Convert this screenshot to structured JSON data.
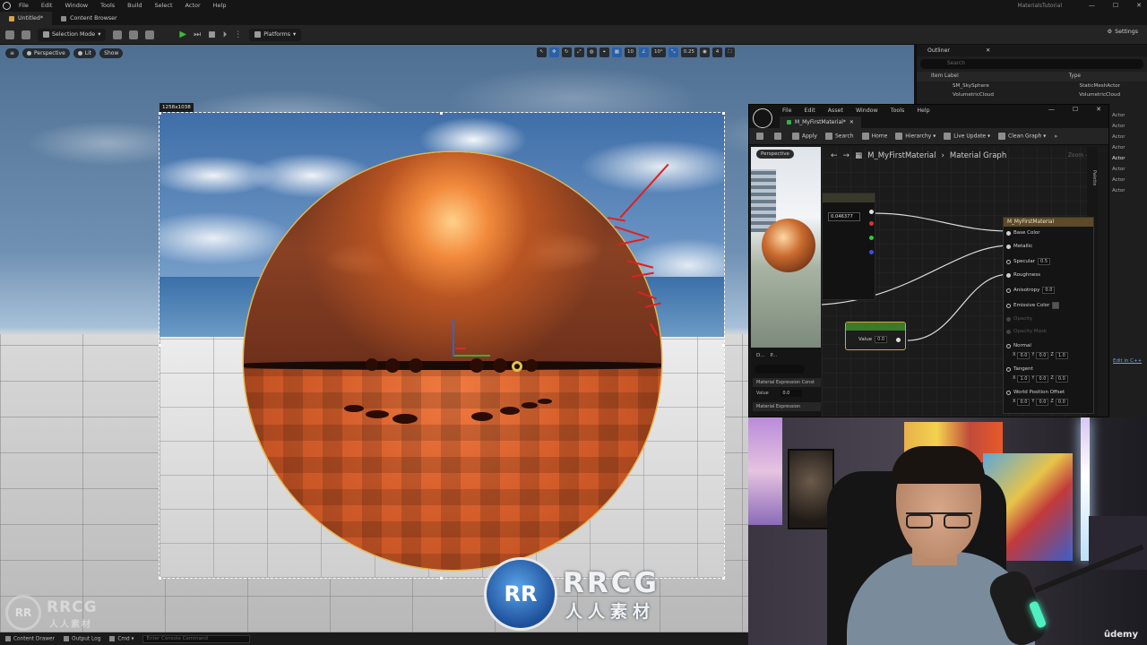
{
  "menubar": {
    "items": [
      "File",
      "Edit",
      "Window",
      "Tools",
      "Build",
      "Select",
      "Actor",
      "Help"
    ],
    "project_title": "MaterialsTutorial",
    "window_controls": [
      "—",
      "☐",
      "✕"
    ]
  },
  "tabs": [
    {
      "label": "Untitled*"
    },
    {
      "label": "Content Browser"
    }
  ],
  "toolbar": {
    "selection_mode": "Selection Mode",
    "platforms": "Platforms",
    "settings": "Settings"
  },
  "viewport": {
    "perspective": "Perspective",
    "lit": "Lit",
    "show": "Show",
    "resolution": "1258x1038",
    "snap_values": [
      "10",
      "10°",
      "0.25",
      "4"
    ]
  },
  "statusbar": {
    "content_drawer": "Content Drawer",
    "output_log": "Output Log",
    "cmd": "Cmd",
    "console_placeholder": "Enter Console Command"
  },
  "outliner": {
    "title": "Outliner",
    "search_placeholder": "Search",
    "col_label": "Item Label",
    "col_type": "Type",
    "rows": [
      {
        "label": "SM_SkySphere",
        "type": "StaticMeshActor"
      },
      {
        "label": "VolumetricCloud",
        "type": "VolumetricCloud"
      }
    ],
    "type_column": [
      "Actor",
      "Actor",
      "Actor",
      "Actor",
      "Actor",
      "Actor",
      "Actor",
      "Actor",
      "Actor",
      "Actor"
    ]
  },
  "material_editor": {
    "menu": [
      "File",
      "Edit",
      "Asset",
      "Window",
      "Tools",
      "Help"
    ],
    "tab_label": "M_MyFirstMaterial*",
    "toolbar": [
      "Apply",
      "Search",
      "Home",
      "Hierarchy",
      "Live Update",
      "Clean Graph"
    ],
    "preview_label": "Perspective",
    "breadcrumb_material": "M_MyFirstMaterial",
    "breadcrumb_graph": "Material Graph",
    "zoom": "Zoom -1",
    "palette": "Palette",
    "constant_value": "0.046377",
    "param_value_label": "Value",
    "param_value": "0.0",
    "details_tabs": [
      "D...",
      "P..."
    ],
    "details_category": "Material Expression Const",
    "details_value_label": "Value",
    "details_value": "0.0",
    "details_category2": "Material Expression",
    "result_node": {
      "title": "M_MyFirstMaterial",
      "pins": [
        {
          "label": "Base Color",
          "box": ""
        },
        {
          "label": "Metallic",
          "box": ""
        },
        {
          "label": "Specular",
          "box": "0.5"
        },
        {
          "label": "Roughness",
          "box": ""
        },
        {
          "label": "Anisotropy",
          "box": "0.0"
        },
        {
          "label": "Emissive Color",
          "box": ""
        },
        {
          "label": "Opacity",
          "box": ""
        },
        {
          "label": "Opacity Mask",
          "box": ""
        },
        {
          "label": "Normal",
          "box": ""
        },
        {
          "label": "Tangent",
          "box": ""
        },
        {
          "label": "World Position Offset",
          "box": ""
        }
      ],
      "normal_vals": [
        "0.0",
        "0.0",
        "1.0"
      ],
      "tangent_vals": [
        "1.0",
        "0.0",
        "0.0"
      ],
      "wpo_vals": [
        "0.0",
        "0.0",
        "0.0"
      ]
    }
  },
  "side_panel": {
    "edit_link": "Edit in C++"
  },
  "watermark": {
    "logo_text": "RR",
    "brand": "RRCG",
    "sub": "人人素材"
  },
  "webcam": {
    "brand": "ûdemy"
  },
  "colors": {
    "accent_blue": "#2a5fa8",
    "selection_outline": "#e6b64d",
    "annotation_red": "#e02020",
    "play_green": "#3dbb3d"
  }
}
